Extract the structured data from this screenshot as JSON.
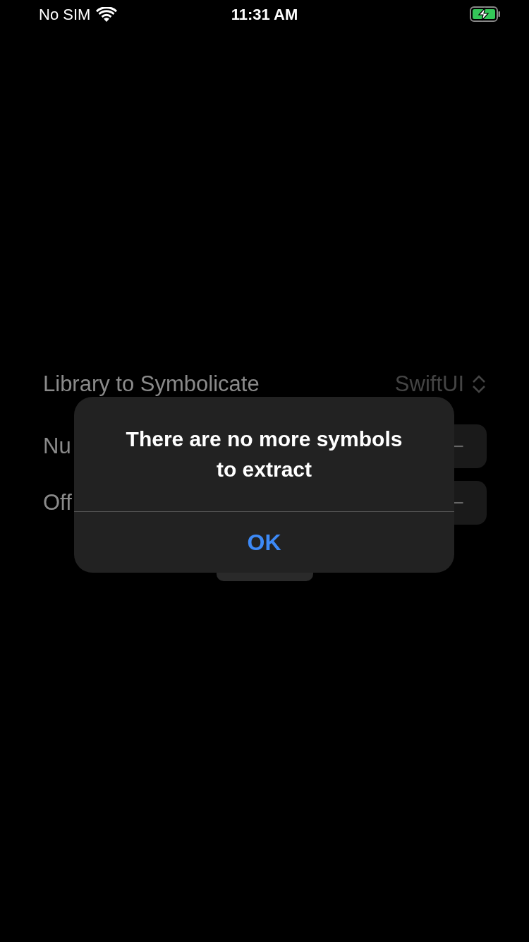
{
  "status_bar": {
    "carrier": "No SIM",
    "time": "11:31 AM",
    "charging": true
  },
  "form": {
    "rows": [
      {
        "kind": "picker",
        "label": "Library to Symbolicate",
        "value": "SwiftUI"
      },
      {
        "kind": "stepper",
        "label": "Nu",
        "control": "−"
      },
      {
        "kind": "stepper",
        "label": "Off",
        "control": "−"
      }
    ]
  },
  "alert": {
    "title": "There are no more symbols to extract",
    "buttons": [
      "OK"
    ]
  }
}
